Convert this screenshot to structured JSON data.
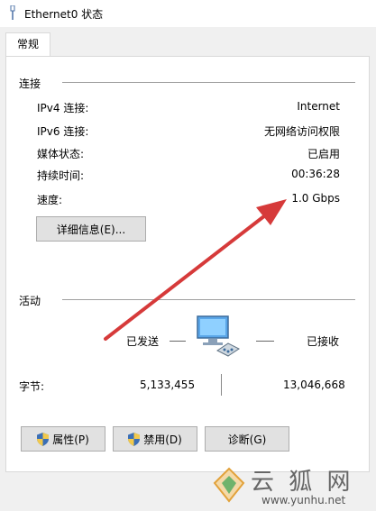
{
  "window": {
    "title": "Ethernet0 状态"
  },
  "tabs": [
    {
      "label": "常规"
    }
  ],
  "connection": {
    "heading": "连接",
    "rows": [
      {
        "label": "IPv4 连接:",
        "value": "Internet"
      },
      {
        "label": "IPv6 连接:",
        "value": "无网络访问权限"
      },
      {
        "label": "媒体状态:",
        "value": "已启用"
      },
      {
        "label": "持续时间:",
        "value": "00:36:28"
      },
      {
        "label": "速度:",
        "value": "1.0 Gbps"
      }
    ],
    "details_button": "详细信息(E)..."
  },
  "activity": {
    "heading": "活动",
    "sent_label": "已发送",
    "received_label": "已接收",
    "bytes_label": "字节:",
    "bytes_sent": "5,133,455",
    "bytes_received": "13,046,668"
  },
  "buttons": {
    "properties": "属性(P)",
    "disable": "禁用(D)",
    "diagnose": "诊断(G)"
  },
  "watermark": {
    "text": "云 狐 网",
    "url": "www.yunhu.net"
  },
  "colors": {
    "arrow": "#d63a3a",
    "accent": "#2f7fd3"
  },
  "icons": [
    "ethernet-icon",
    "network-computer-icon",
    "shield-icon",
    "red-arrow-annotation"
  ]
}
